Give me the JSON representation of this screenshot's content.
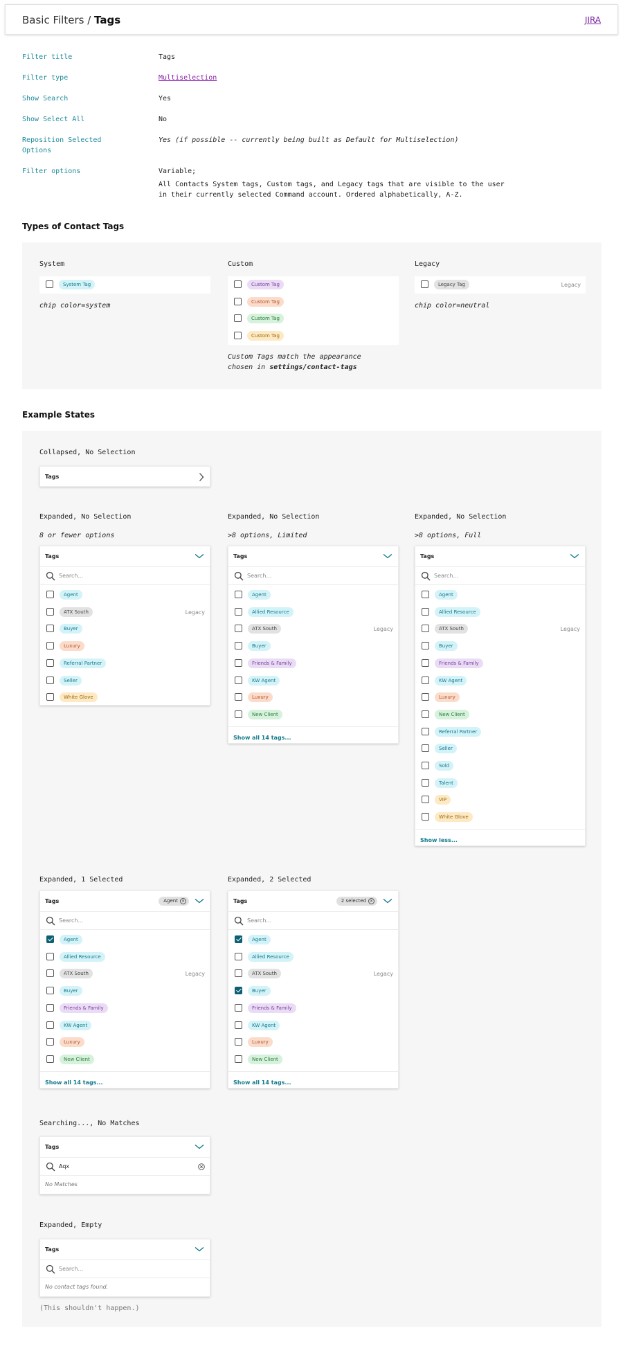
{
  "header": {
    "crumb_parent": "Basic Filters /",
    "crumb_current": "Tags",
    "jira": "JIRA"
  },
  "props": [
    {
      "label": "Filter title",
      "value": "Tags"
    },
    {
      "label": "Filter type",
      "value": "Multiselection"
    },
    {
      "label": "Show Search",
      "value": "Yes"
    },
    {
      "label": "Show Select All",
      "value": "No"
    },
    {
      "label": "Reposition Selected",
      "label2": "Options",
      "value": "Yes (if possible -- currently being built as Default for Multiselection)"
    },
    {
      "label": "Filter options",
      "value": "Variable;",
      "value2": "All Contacts System tags, Custom tags, and Legacy tags that are visible to the user",
      "value3": "in their currently selected Command account. Ordered alphabetically, A-Z."
    }
  ],
  "types": {
    "title": "Types of Contact Tags",
    "system": {
      "head": "System",
      "chip": "System Tag",
      "note": "chip color=system"
    },
    "custom": {
      "head": "Custom",
      "chips": [
        "Custom Tag",
        "Custom Tag",
        "Custom Tag",
        "Custom Tag"
      ],
      "note1": "Custom Tags match the appearance",
      "note2_pre": "chosen in ",
      "note2_bold": "settings/contact-tags"
    },
    "legacy": {
      "head": "Legacy",
      "chip": "Legacy Tag",
      "legacy_label": "Legacy",
      "note": "chip color=neutral"
    }
  },
  "colors": {
    "system_bg": "#d4f3f8",
    "system_fg": "#137a8c",
    "purple_bg": "#eadcf5",
    "purple_fg": "#7b3fa0",
    "orange_bg": "#fbdccb",
    "orange_fg": "#b4532a",
    "green_bg": "#d6f1dc",
    "green_fg": "#2e7d3a",
    "yellow_bg": "#fdeac4",
    "yellow_fg": "#9a6a0e",
    "neutral_bg": "#e2e2e2",
    "neutral_fg": "#444",
    "accent": "#137a8c"
  },
  "states": {
    "title": "Example States",
    "collapsed": {
      "head": "Collapsed, No Selection",
      "label": "Tags"
    },
    "exp1": {
      "head": "Expanded, No Selection",
      "note": "8 or fewer options",
      "label": "Tags",
      "search": "Search...",
      "rows": [
        "Agent",
        "ATX South",
        "Buyer",
        "Luxury",
        "Referral Partner",
        "Seller",
        "White Glove"
      ]
    },
    "exp2": {
      "head": "Expanded, No Selection",
      "note": ">8 options, Limited",
      "label": "Tags",
      "search": "Search...",
      "rows": [
        "Agent",
        "Allied Resource",
        "ATX South",
        "Buyer",
        "Friends & Family",
        "KW Agent",
        "Luxury",
        "New Client"
      ],
      "show": "Show all 14 tags..."
    },
    "exp3": {
      "head": "Expanded, No Selection",
      "note": ">8 options, Full",
      "label": "Tags",
      "search": "Search...",
      "rows": [
        "Agent",
        "Allied Resource",
        "ATX South",
        "Buyer",
        "Friends & Family",
        "KW Agent",
        "Luxury",
        "New Client",
        "Referral Partner",
        "Seller",
        "Sold",
        "Talent",
        "VIP",
        "White Glove"
      ],
      "show": "Show less..."
    },
    "sel1": {
      "head": "Expanded, 1 Selected",
      "label": "Tags",
      "selected_chip": "Agent",
      "search": "Search...",
      "rows": [
        "Agent",
        "Allied Resource",
        "ATX South",
        "Buyer",
        "Friends & Family",
        "KW Agent",
        "Luxury",
        "New Client"
      ],
      "show": "Show all 14 tags..."
    },
    "sel2": {
      "head": "Expanded, 2 Selected",
      "label": "Tags",
      "selected_chip": "2 selected",
      "search": "Search...",
      "rows": [
        "Agent",
        "Allied Resource",
        "ATX South",
        "Buyer",
        "Friends & Family",
        "KW Agent",
        "Luxury",
        "New Client"
      ],
      "show": "Show all 14 tags..."
    },
    "nomatch": {
      "head": "Searching..., No Matches",
      "label": "Tags",
      "query": "Aqx",
      "msg": "No Matches"
    },
    "empty": {
      "head": "Expanded, Empty",
      "label": "Tags",
      "search": "Search...",
      "msg": "No contact tags found.",
      "footnote": "(This shouldn't happen.)"
    },
    "legacy_label": "Legacy"
  }
}
